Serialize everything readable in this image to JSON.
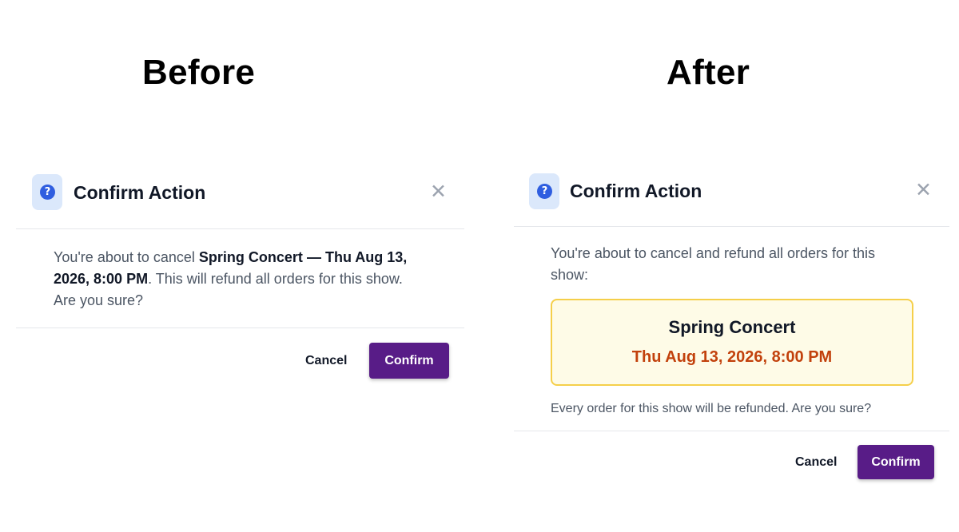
{
  "headings": {
    "before": "Before",
    "after": "After"
  },
  "dialog_title": "Confirm Action",
  "close_glyph": "✕",
  "help_glyph": "?",
  "icons": {
    "help": "question-circle-icon",
    "close": "close-icon"
  },
  "before": {
    "text_prefix": "You're about to cancel ",
    "show_name": "Spring Concert",
    "separator": " — ",
    "show_date": "Thu Aug 13, 2026, 8:00 PM",
    "text_suffix": ". This will refund all orders for this show. Are you sure?",
    "cancel_label": "Cancel",
    "confirm_label": "Confirm"
  },
  "after": {
    "intro": "You're about to cancel and refund all orders for this show:",
    "show_name": "Spring Concert",
    "show_date": "Thu Aug 13, 2026, 8:00 PM",
    "note": "Every order for this show will be refunded. Are you sure?",
    "cancel_label": "Cancel",
    "confirm_label": "Confirm"
  },
  "colors": {
    "primary": "#581c87",
    "icon_blue": "#2f5ee0",
    "badge_bg": "#dbe8fb",
    "highlight_border": "#f5cf4a",
    "highlight_bg": "#fefbe7",
    "date_accent": "#c2410c"
  }
}
